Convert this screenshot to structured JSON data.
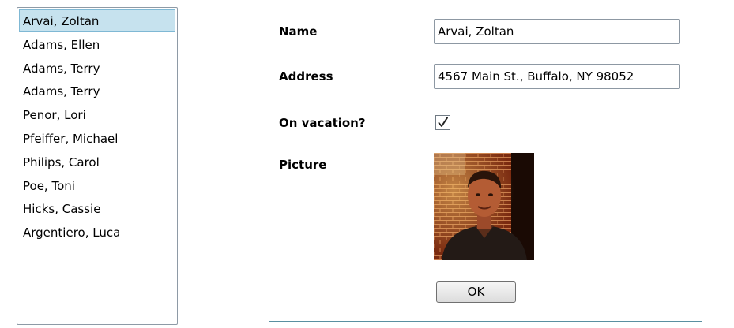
{
  "list": {
    "items": [
      "Arvai, Zoltan",
      "Adams, Ellen",
      "Adams, Terry",
      "Adams, Terry",
      "Penor, Lori",
      "Pfeiffer, Michael",
      "Philips, Carol",
      "Poe, Toni",
      "Hicks, Cassie",
      "Argentiero, Luca"
    ],
    "selected_index": 0
  },
  "details": {
    "name_label": "Name",
    "name_value": "Arvai, Zoltan",
    "address_label": "Address",
    "address_value": "4567 Main St., Buffalo, NY 98052",
    "vacation_label": "On vacation?",
    "vacation_checked": true,
    "picture_label": "Picture",
    "ok_label": "OK"
  },
  "colors": {
    "selection_bg": "#c6e2ee",
    "selection_border": "#7fb8d4",
    "panel_border": "#5a8fa0"
  },
  "icons": {
    "checkbox": "checkmark-icon",
    "picture": "person-photo"
  }
}
